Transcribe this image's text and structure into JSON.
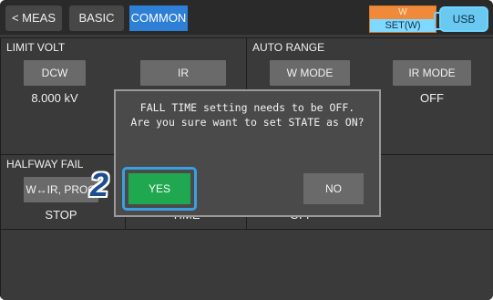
{
  "tabs": {
    "meas": "< MEAS",
    "basic": "BASIC",
    "common": "COMMON"
  },
  "status": {
    "w_label": "W",
    "setw_label": "SET(W)",
    "usb_label": "USB"
  },
  "limit_volt": {
    "title": "LIMIT VOLT",
    "dcw_label": "DCW",
    "dcw_value": "8.000 kV",
    "ir_label": "IR"
  },
  "auto_range": {
    "title": "AUTO RANGE",
    "w_mode_label": "W MODE",
    "ir_mode_label": "IR MODE",
    "ir_mode_value": "OFF"
  },
  "halfway_fail": {
    "title": "HALFWAY FAIL",
    "button_label": "W↔IR, PROG",
    "value": "STOP",
    "col2_value_partial": "TIME",
    "col3_value_partial": "OFF"
  },
  "dialog": {
    "line1": "FALL TIME setting needs to be OFF.",
    "line2": "Are you sure want to set STATE as ON?",
    "yes_label": "YES",
    "no_label": "NO"
  },
  "step_marker": "2",
  "colors": {
    "accent_blue": "#2e7fd6",
    "yes_green": "#1fa84f",
    "highlight_frame": "#3aa0e0"
  }
}
